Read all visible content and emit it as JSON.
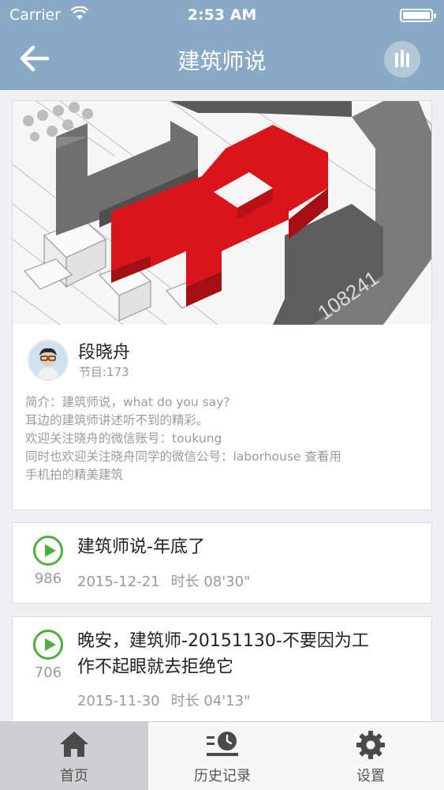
{
  "status_bar": {
    "carrier": "Carrier",
    "time": "2:53 AM"
  },
  "nav": {
    "title": "建筑师说"
  },
  "feature": {
    "image_label": "108241",
    "author": "段晓舟",
    "episodes": "节目:173",
    "intro_lines": [
      "简介：建筑师说，what do you say?",
      "耳边的建筑师讲述听不到的精彩。",
      "欢迎关注晓舟的微信账号：toukung",
      "同时也欢迎关注晓舟同学的微信公号：laborhouse 查看用",
      "手机拍的精美建筑"
    ]
  },
  "episodes": [
    {
      "title": "建筑师说-年底了",
      "plays": "986",
      "date": "2015-12-21",
      "duration": "时长 08'30\""
    },
    {
      "title_lines": [
        "晚安，建筑师-20151130-不要因为工",
        "作不起眼就去拒绝它"
      ],
      "plays": "706",
      "date": "2015-11-30",
      "duration": "时长 04'13\""
    }
  ],
  "tabs": [
    {
      "label": "首页",
      "icon": "home-icon",
      "active": true
    },
    {
      "label": "历史记录",
      "icon": "history-icon",
      "active": false
    },
    {
      "label": "设置",
      "icon": "gear-icon",
      "active": false
    }
  ],
  "colors": {
    "nav_bar": "#8aa9c4",
    "play_green": "#4cae3c",
    "building_red": "#d9141b"
  }
}
